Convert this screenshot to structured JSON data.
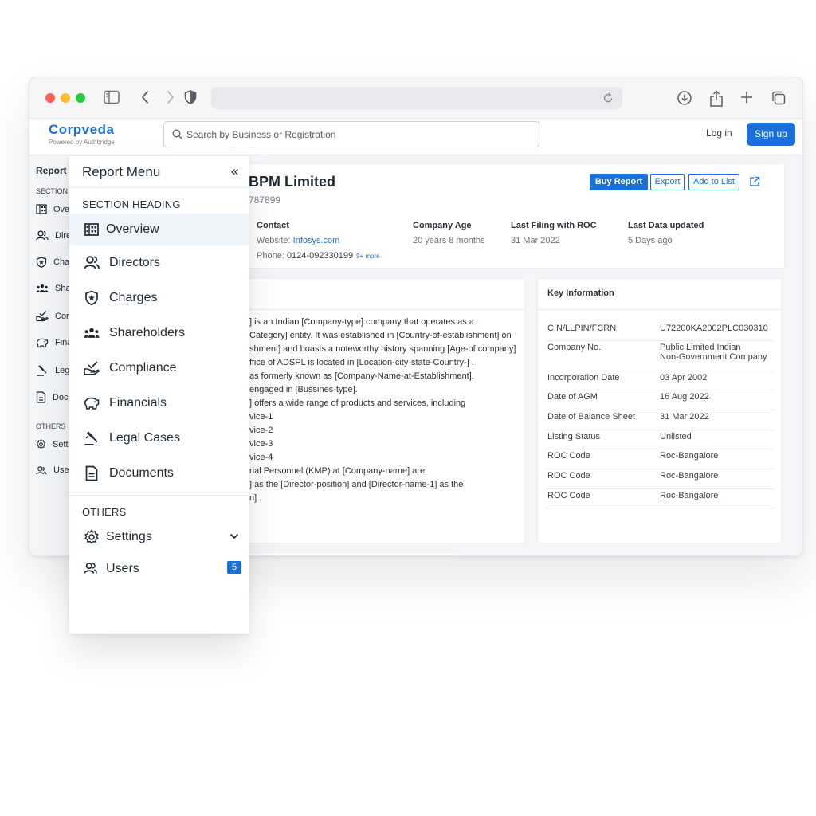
{
  "site": {
    "logo_name": "Corpveda",
    "logo_sub": "Powered by Authbridge",
    "search_placeholder": "Search by Business or Registration",
    "login": "Log in",
    "signup": "Sign up"
  },
  "bg_nav": {
    "title": "Report",
    "section": "SECTION",
    "others": "OTHERS",
    "items": [
      "Ove",
      "Dire",
      "Cha",
      "Sha",
      "Cor",
      "Fina",
      "Leg",
      "Doc",
      "Sett",
      "Use"
    ]
  },
  "company": {
    "name": "BPM Limited",
    "id": "787899",
    "buy_report": "Buy Report",
    "export": "Export",
    "add_to_list": "Add to List",
    "contact_label": "Contact",
    "website_label": "Website:",
    "website": "Infosys.com",
    "phone_label": "Phone:",
    "phone": "0124-092330199",
    "phone_more": "9+ more",
    "age_label": "Company Age",
    "age": "20 years 8 months",
    "filing_label": "Last Filing with ROC",
    "filing": "31 Mar 2022",
    "updated_label": "Last Data updated",
    "updated": "5 Days ago"
  },
  "about": {
    "lines": [
      "] is an Indian [Company-type] company that operates as a",
      "Category]  entity. It was established in [Country-of-establishment] on",
      "shment] and boasts a noteworthy history spanning [Age-of company]",
      "ffice of ADSPL is located in  [Location-city-state-Country-] .",
      "as formerly known as [Company-Name-at-Establishment].",
      "engaged in [Bussines-type].",
      "] offers a wide range of products and services, including",
      "vice-1",
      "vice-2",
      "vice-3",
      "vice-4",
      "rial Personnel (KMP) at [Company-name] are",
      "] as the [Director-position] and [Director-name-1] as the",
      "n] ."
    ]
  },
  "key_info": {
    "title": "Key Information",
    "rows": [
      {
        "k": "CIN/LLPIN/FCRN",
        "v": "U72200KA2002PLC030310"
      },
      {
        "k": "Company No.",
        "v": "Public Limited Indian",
        "v2": "Non-Government Company"
      },
      {
        "k": "Incorporation Date",
        "v": "03 Apr 2002"
      },
      {
        "k": "Date of AGM",
        "v": "16 Aug 2022"
      },
      {
        "k": "Date of Balance Sheet",
        "v": "31 Mar 2022"
      },
      {
        "k": "Listing Status",
        "v": "Unlisted"
      },
      {
        "k": "ROC Code",
        "v": "Roc-Bangalore"
      },
      {
        "k": "ROC Code",
        "v": "Roc-Bangalore"
      },
      {
        "k": "ROC Code",
        "v": "Roc-Bangalore"
      }
    ]
  },
  "menu": {
    "title": "Report Menu",
    "collapse": "«",
    "section_heading": "SECTION HEADING",
    "items": [
      {
        "label": "Overview",
        "icon": "building-icon"
      },
      {
        "label": "Directors",
        "icon": "users-icon"
      },
      {
        "label": "Charges",
        "icon": "shield-star-icon"
      },
      {
        "label": "Shareholders",
        "icon": "group-icon"
      },
      {
        "label": "Compliance",
        "icon": "hand-check-icon"
      },
      {
        "label": "Financials",
        "icon": "piggy-bank-icon"
      },
      {
        "label": "Legal Cases",
        "icon": "gavel-icon"
      },
      {
        "label": "Documents",
        "icon": "document-icon"
      }
    ],
    "others_heading": "OTHERS",
    "settings": "Settings",
    "users": "Users",
    "users_badge": "5"
  }
}
